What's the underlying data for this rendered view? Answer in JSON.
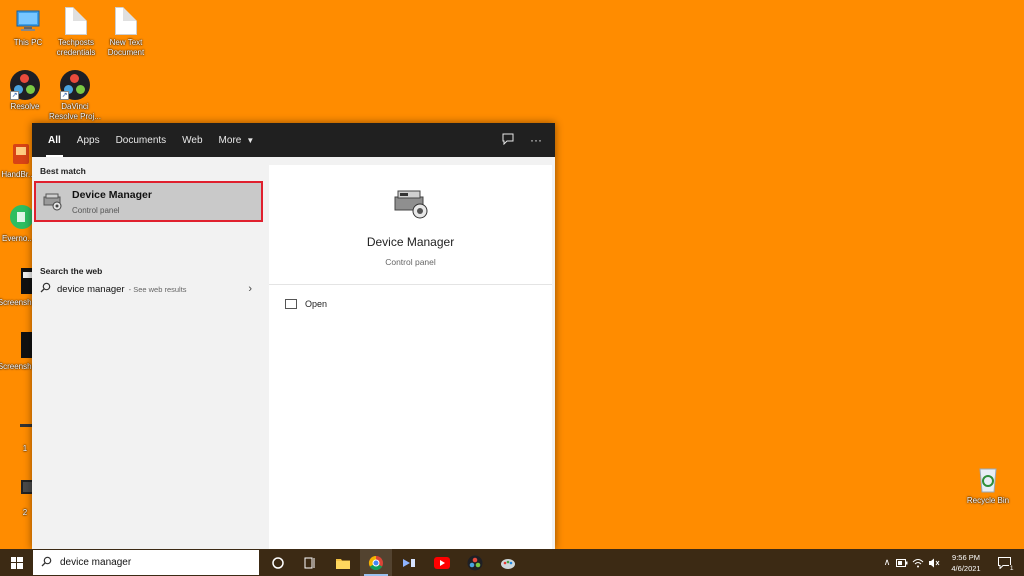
{
  "desktop": {
    "icons": [
      {
        "label": "This PC"
      },
      {
        "label": "Techposts credentials"
      },
      {
        "label": "New Text Document"
      },
      {
        "label": "Resolve"
      },
      {
        "label": "DaVinci Resolve Proj..."
      },
      {
        "label": "HandBr..."
      },
      {
        "label": "Everno..."
      },
      {
        "label": "Screensh..."
      },
      {
        "label": "Screensh..."
      },
      {
        "label": "1"
      },
      {
        "label": "2"
      },
      {
        "label": "Recycle Bin"
      }
    ]
  },
  "search_panel": {
    "tabs": [
      {
        "label": "All"
      },
      {
        "label": "Apps"
      },
      {
        "label": "Documents"
      },
      {
        "label": "Web"
      },
      {
        "label": "More"
      }
    ],
    "best_match_heading": "Best match",
    "best_match": {
      "title": "Device Manager",
      "subtitle": "Control panel"
    },
    "search_web_heading": "Search the web",
    "web_result": {
      "term": "device manager",
      "hint": "- See web results"
    },
    "detail": {
      "title": "Device Manager",
      "subtitle": "Control panel",
      "open_label": "Open"
    }
  },
  "taskbar": {
    "search_value": "device manager",
    "clock_time": "9:56 PM",
    "clock_date": "4/6/2021",
    "notification_count": "1"
  },
  "colors": {
    "desktop_bg": "#FF8C00",
    "taskbar_bg": "#3C2A14",
    "highlight_border": "#E0202E"
  }
}
